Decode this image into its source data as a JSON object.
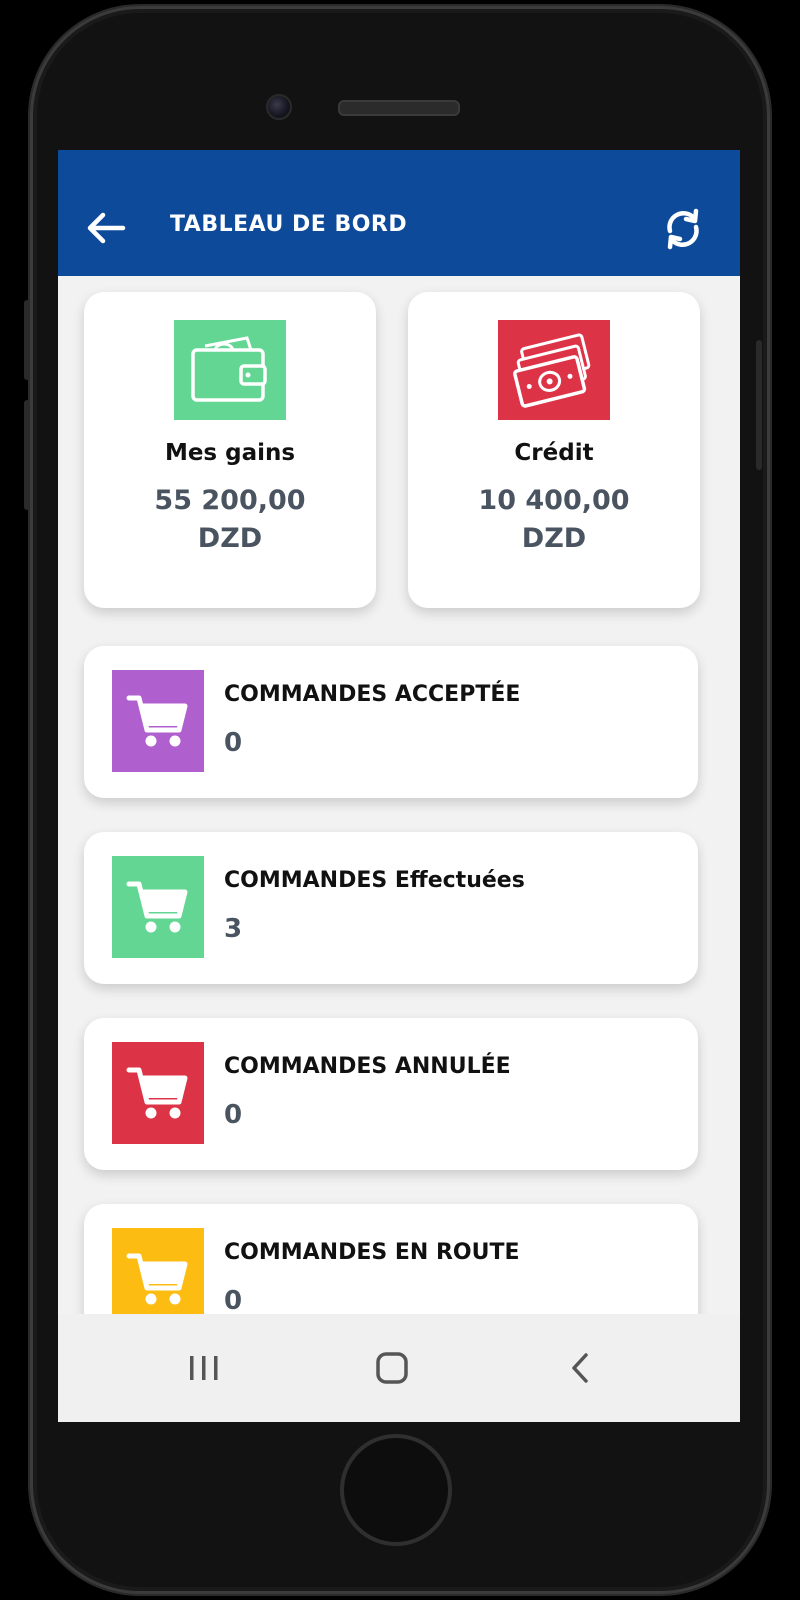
{
  "header": {
    "title": "TABLEAU DE BORD",
    "back_icon": "arrow-left-icon",
    "refresh_icon": "refresh-icon",
    "color": "#0e4a9a"
  },
  "summary": [
    {
      "label": "Mes gains",
      "amount_line1": "55 200,00",
      "amount_line2": "DZD",
      "icon": "wallet-icon",
      "color": "#62d692"
    },
    {
      "label": "Crédit",
      "amount_line1": "10 400,00",
      "amount_line2": "DZD",
      "icon": "banknotes-icon",
      "color": "#dd3347"
    }
  ],
  "orders": [
    {
      "label": "COMMANDES ACCEPTÉE",
      "count": "0",
      "icon": "cart-icon",
      "color": "#b05fcf"
    },
    {
      "label": "COMMANDES Effectuées",
      "count": "3",
      "icon": "cart-icon",
      "color": "#62d692"
    },
    {
      "label": "COMMANDES ANNULÉE",
      "count": "0",
      "icon": "cart-icon",
      "color": "#dd3347"
    },
    {
      "label": "COMMANDES EN ROUTE",
      "count": "0",
      "icon": "cart-icon",
      "color": "#fcbc12"
    }
  ],
  "navbar": {
    "recents_icon": "recents-icon",
    "home_icon": "home-icon",
    "back_icon": "nav-back-icon"
  }
}
